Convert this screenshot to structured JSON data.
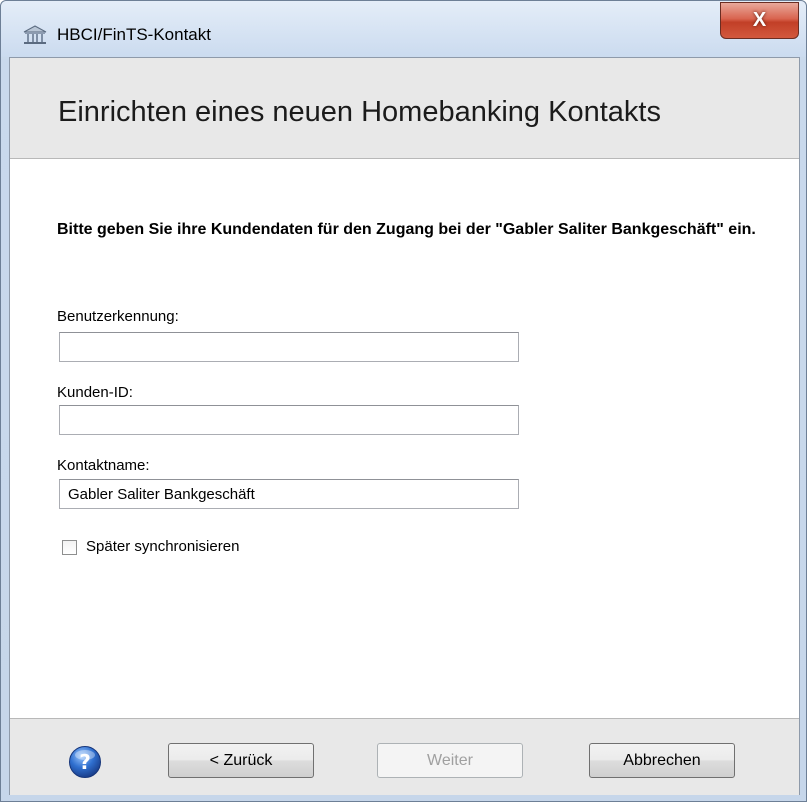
{
  "window": {
    "title": "HBCI/FinTS-Kontakt",
    "close_glyph": "X"
  },
  "header": {
    "title": "Einrichten eines neuen Homebanking Kontakts"
  },
  "instructions": "Bitte geben Sie ihre Kundendaten für den Zugang bei der \"Gabler Saliter Bankgeschäft\" ein.",
  "form": {
    "user_id": {
      "label": "Benutzerkennung:",
      "value": ""
    },
    "customer_id": {
      "label": "Kunden-ID:",
      "value": ""
    },
    "contact_name": {
      "label": "Kontaktname:",
      "value": "Gabler Saliter Bankgeschäft"
    },
    "sync_later": {
      "label": "Später synchronisieren",
      "checked": false
    }
  },
  "footer": {
    "back_label": "< Zurück",
    "next_label": "Weiter",
    "cancel_label": "Abbrechen",
    "help_glyph": "?"
  },
  "colors": {
    "close_button": "#c94a33",
    "help_icon": "#2f6fcf"
  }
}
